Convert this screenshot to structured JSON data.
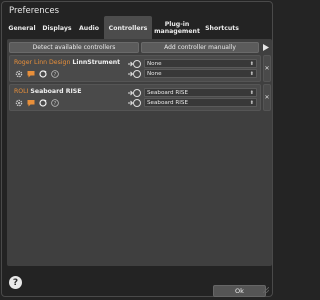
{
  "window": {
    "title": "Preferences"
  },
  "tabs": [
    {
      "label": "General"
    },
    {
      "label": "Displays"
    },
    {
      "label": "Audio"
    },
    {
      "label": "Controllers",
      "active": true
    },
    {
      "label": "Plug-in management"
    },
    {
      "label": "Shortcuts"
    }
  ],
  "toolbar": {
    "detect_label": "Detect available controllers",
    "add_label": "Add controller manually",
    "expand_icon": "triangle-right-icon"
  },
  "controllers": [
    {
      "vendor": "Roger Linn Design",
      "model": "LinnStrument",
      "input_port": "None",
      "output_port": "None"
    },
    {
      "vendor": "ROLI",
      "model": "Seaboard RISE",
      "input_port": "Seaboard RISE",
      "output_port": "Seaboard RISE"
    }
  ],
  "footer": {
    "ok_label": "Ok",
    "help_icon": "?"
  },
  "colors": {
    "vendor": "#e88f3a",
    "panel": "#3f3f3f",
    "background": "#232323"
  }
}
